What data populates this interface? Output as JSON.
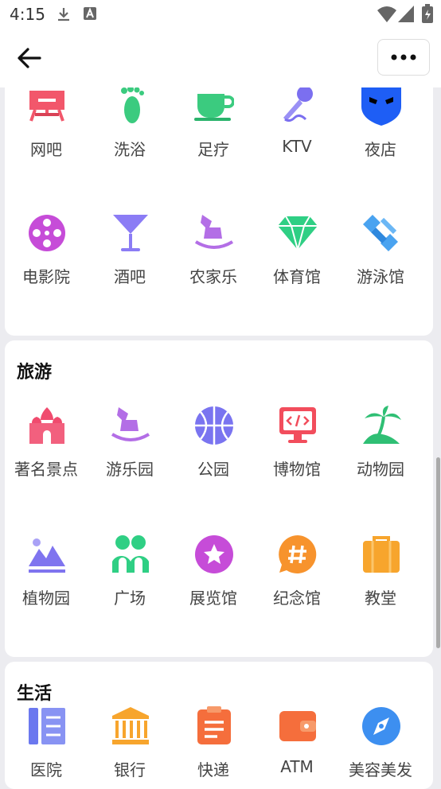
{
  "status_bar": {
    "time": "4:15"
  },
  "sections": [
    {
      "title": "",
      "items": [
        {
          "label": "网吧",
          "icon": "internet-cafe-icon"
        },
        {
          "label": "洗浴",
          "icon": "footprint-icon"
        },
        {
          "label": "足疗",
          "icon": "teacup-icon"
        },
        {
          "label": "KTV",
          "icon": "microphone-icon"
        },
        {
          "label": "夜店",
          "icon": "mask-icon"
        },
        {
          "label": "电影院",
          "icon": "film-reel-icon"
        },
        {
          "label": "酒吧",
          "icon": "cocktail-icon"
        },
        {
          "label": "农家乐",
          "icon": "rocking-horse-icon"
        },
        {
          "label": "体育馆",
          "icon": "diamond-icon"
        },
        {
          "label": "游泳馆",
          "icon": "satellite-icon"
        }
      ]
    },
    {
      "title": "旅游",
      "items": [
        {
          "label": "著名景点",
          "icon": "palace-icon"
        },
        {
          "label": "游乐园",
          "icon": "rocking-horse-icon"
        },
        {
          "label": "公园",
          "icon": "ball-icon"
        },
        {
          "label": "博物馆",
          "icon": "code-monitor-icon"
        },
        {
          "label": "动物园",
          "icon": "palm-island-icon"
        },
        {
          "label": "植物园",
          "icon": "mountain-icon"
        },
        {
          "label": "广场",
          "icon": "people-icon"
        },
        {
          "label": "展览馆",
          "icon": "star-badge-icon"
        },
        {
          "label": "纪念馆",
          "icon": "hashtag-bubble-icon"
        },
        {
          "label": "教堂",
          "icon": "briefcase-icon"
        }
      ]
    },
    {
      "title": "生活",
      "items": [
        {
          "label": "医院",
          "icon": "list-columns-icon"
        },
        {
          "label": "银行",
          "icon": "bank-icon"
        },
        {
          "label": "快递",
          "icon": "clipboard-icon"
        },
        {
          "label": "ATM",
          "icon": "wallet-icon"
        },
        {
          "label": "美容美发",
          "icon": "compass-icon"
        }
      ]
    }
  ]
}
